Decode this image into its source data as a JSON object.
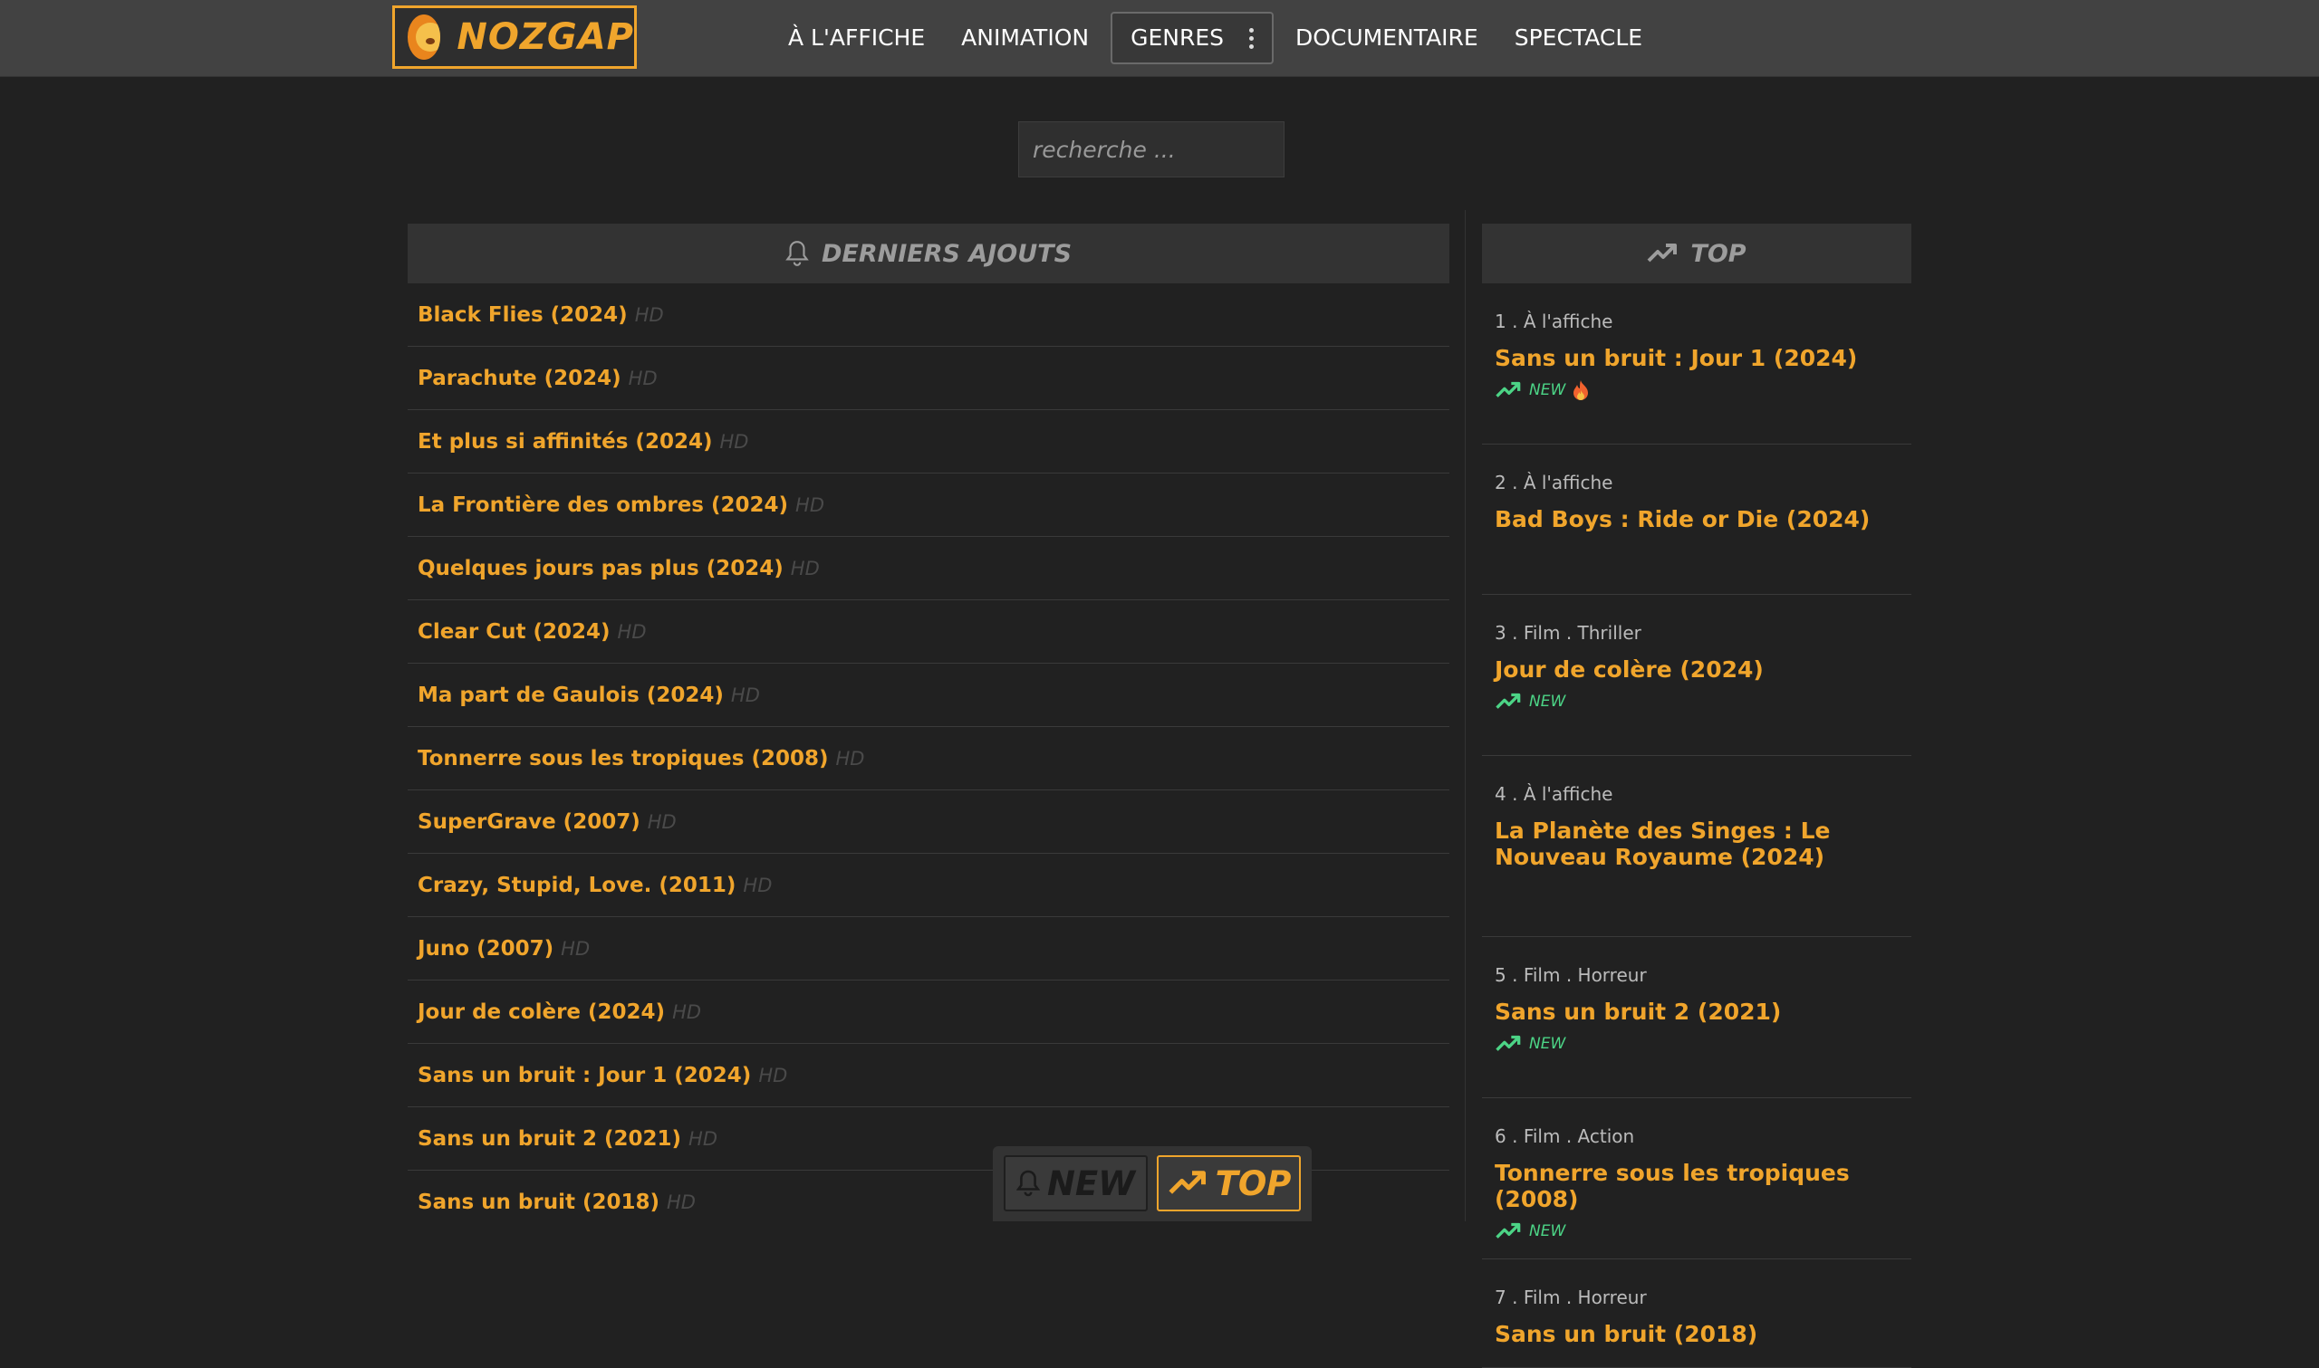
{
  "brand": {
    "name": "NOZGAP"
  },
  "nav": {
    "items": [
      "À L'AFFICHE",
      "ANIMATION",
      "GENRES",
      "DOCUMENTAIRE",
      "SPECTACLE"
    ]
  },
  "search": {
    "placeholder": "recherche ..."
  },
  "latest": {
    "title": "DERNIERS AJOUTS",
    "items": [
      {
        "title": "Black Flies (2024)",
        "quality": "HD"
      },
      {
        "title": "Parachute (2024)",
        "quality": "HD"
      },
      {
        "title": "Et plus si affinités (2024)",
        "quality": "HD"
      },
      {
        "title": "La Frontière des ombres (2024)",
        "quality": "HD"
      },
      {
        "title": "Quelques jours pas plus (2024)",
        "quality": "HD"
      },
      {
        "title": "Clear Cut (2024)",
        "quality": "HD"
      },
      {
        "title": "Ma part de Gaulois (2024)",
        "quality": "HD"
      },
      {
        "title": "Tonnerre sous les tropiques (2008)",
        "quality": "HD"
      },
      {
        "title": "SuperGrave (2007)",
        "quality": "HD"
      },
      {
        "title": "Crazy, Stupid, Love. (2011)",
        "quality": "HD"
      },
      {
        "title": "Juno (2007)",
        "quality": "HD"
      },
      {
        "title": "Jour de colère (2024)",
        "quality": "HD"
      },
      {
        "title": "Sans un bruit : Jour 1 (2024)",
        "quality": "HD"
      },
      {
        "title": "Sans un bruit 2 (2021)",
        "quality": "HD"
      },
      {
        "title": "Sans un bruit (2018)",
        "quality": "HD"
      }
    ]
  },
  "top": {
    "title": "TOP",
    "new_label": "NEW",
    "items": [
      {
        "rank": "1",
        "category": "À l'affiche",
        "title": "Sans un bruit : Jour 1 (2024)",
        "is_new": true,
        "hot": true
      },
      {
        "rank": "2",
        "category": "À l'affiche",
        "title": "Bad Boys : Ride or Die (2024)",
        "is_new": false,
        "hot": false
      },
      {
        "rank": "3",
        "category": "Film . Thriller",
        "title": "Jour de colère (2024)",
        "is_new": true,
        "hot": false
      },
      {
        "rank": "4",
        "category": "À l'affiche",
        "title": "La Planète des Singes : Le Nouveau Royaume (2024)",
        "is_new": false,
        "hot": false
      },
      {
        "rank": "5",
        "category": "Film . Horreur",
        "title": "Sans un bruit 2 (2021)",
        "is_new": true,
        "hot": false
      },
      {
        "rank": "6",
        "category": "Film . Action",
        "title": "Tonnerre sous les tropiques (2008)",
        "is_new": true,
        "hot": false
      },
      {
        "rank": "7",
        "category": "Film . Horreur",
        "title": "Sans un bruit (2018)",
        "is_new": false,
        "hot": false
      }
    ]
  },
  "floating": {
    "new_label": "NEW",
    "top_label": "TOP",
    "active": "top"
  },
  "colors": {
    "accent": "#f0a52c",
    "new_green": "#4cd486",
    "background": "#212121",
    "header": "#424242"
  }
}
